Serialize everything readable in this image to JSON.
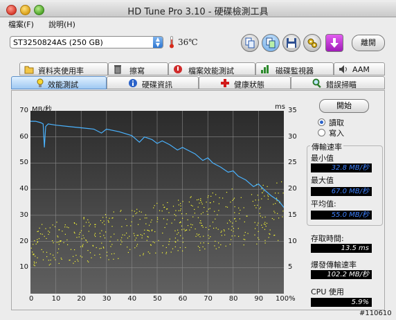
{
  "window": {
    "title": "HD Tune Pro 3.10 - 硬碟檢測工具"
  },
  "menu": [
    {
      "label": "檔案(F)"
    },
    {
      "label": "說明(H)"
    }
  ],
  "toolbar": {
    "drive": "ST3250824AS (250 GB)",
    "temperature": "36℃",
    "exit_label": "離開"
  },
  "tabs_top": [
    {
      "label": "資料夾使用率"
    },
    {
      "label": "擦寫"
    },
    {
      "label": "檔案效能測試"
    },
    {
      "label": "磁碟監視器"
    },
    {
      "label": "AAM"
    }
  ],
  "tabs_bottom": [
    {
      "label": "效能測試",
      "active": true
    },
    {
      "label": "硬碟資訊"
    },
    {
      "label": "健康狀態"
    },
    {
      "label": "錯誤掃瞄"
    }
  ],
  "chart": {
    "left_unit": "MB/秒",
    "right_unit": "ms",
    "x_ticks": [
      "0",
      "10",
      "20",
      "30",
      "40",
      "50",
      "60",
      "70",
      "80",
      "90",
      "100%"
    ],
    "y_left_ticks": [
      "70",
      "60",
      "50",
      "40",
      "30",
      "20",
      "10"
    ],
    "y_right_ticks": [
      "35",
      "30",
      "25",
      "20",
      "15",
      "10",
      "5"
    ]
  },
  "controls": {
    "start_label": "開始",
    "read_label": "讀取",
    "write_label": "寫入",
    "mode": "read"
  },
  "stats": {
    "group_title": "傳輸速率",
    "min_label": "最小值",
    "min_value": "32.8 MB/秒",
    "max_label": "最大值",
    "max_value": "67.0 MB/秒",
    "avg_label": "平均值:",
    "avg_value": "55.0 MB/秒",
    "access_label": "存取時間:",
    "access_value": "13.5 ms",
    "burst_label": "爆發傳輸速率",
    "burst_value": "102.2 MB/秒",
    "cpu_label": "CPU 使用",
    "cpu_value": "5.9%"
  },
  "footer_id": "#110610",
  "chart_data": {
    "type": "line",
    "title": "",
    "xlabel": "",
    "ylabel": "MB/秒",
    "y2label": "ms",
    "xlim": [
      0,
      100
    ],
    "ylim": [
      0,
      70
    ],
    "y2lim": [
      0,
      35
    ],
    "grid": true,
    "series": [
      {
        "axis": "left",
        "style": "line",
        "color": "#4ab3ff",
        "x": [
          0,
          2,
          4,
          5,
          5.5,
          6,
          7,
          10,
          15,
          20,
          25,
          28,
          30,
          35,
          40,
          43,
          45,
          48,
          50,
          52,
          55,
          58,
          60,
          62,
          65,
          68,
          70,
          72,
          75,
          78,
          80,
          82,
          85,
          88,
          90,
          92,
          95,
          98,
          100
        ],
        "values": [
          66,
          66,
          65.5,
          65,
          56,
          64,
          65,
          64.5,
          64,
          63.5,
          63,
          61.5,
          63,
          62,
          60.5,
          58,
          60,
          59,
          57.5,
          58.5,
          57,
          55,
          56,
          55,
          53.5,
          51,
          52,
          50,
          48.5,
          46.5,
          47,
          45,
          43.5,
          41,
          42,
          40,
          37.5,
          35.5,
          33
        ]
      },
      {
        "axis": "right",
        "style": "scatter",
        "color": "#ffff33",
        "note": "access time samples (ms)",
        "x_range": [
          0,
          100
        ],
        "y_range_start": [
          5,
          13
        ],
        "y_range_end": [
          10,
          22
        ]
      }
    ]
  }
}
